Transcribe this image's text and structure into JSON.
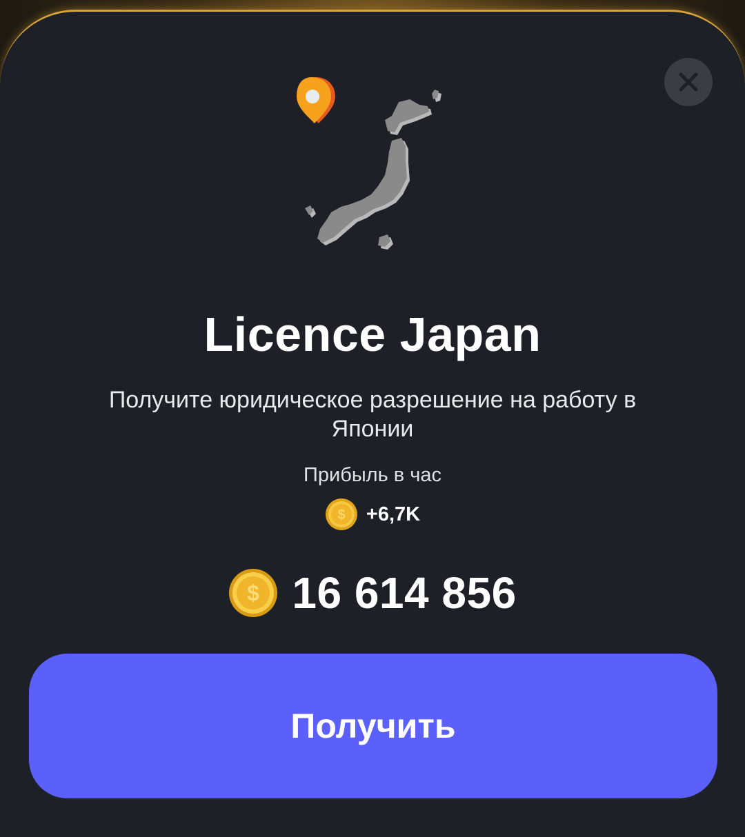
{
  "card": {
    "title": "Licence Japan",
    "description": "Получите юридическое разрешение на работу в Японии",
    "profit_label": "Прибыль в час",
    "profit_value": "+6,7K",
    "price": "16 614 856",
    "button_label": "Получить",
    "illustration_icon": "japan-map-with-location-pin",
    "close_icon": "close-icon",
    "coin_icon": "gold-dollar-coin-icon"
  },
  "colors": {
    "background": "#1d2026",
    "button": "#5b60fb",
    "border_accent": "#d6a43a",
    "pin": "#f08a1c"
  }
}
